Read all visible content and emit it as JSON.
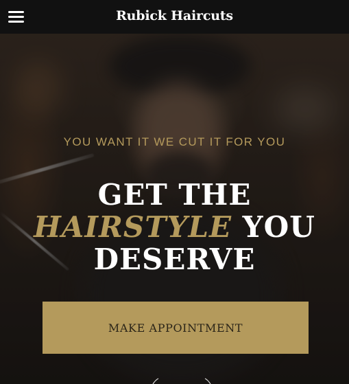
{
  "navbar": {
    "menu_icon": "hamburger-menu-icon",
    "brand": "Rubick Haircuts"
  },
  "hero": {
    "tagline": "YOU WANT IT WE CUT IT FOR YOU",
    "headline": {
      "line1": "GET THE",
      "accent": "HAIRSTYLE",
      "line2_rest": " YOU",
      "line3": "DESERVE"
    },
    "cta_label": "MAKE APPOINTMENT",
    "ornament_icon": "divider-ornament-icon"
  },
  "colors": {
    "accent": "#b49a5c",
    "navbar_bg": "#111111",
    "text_light": "#ffffff"
  }
}
